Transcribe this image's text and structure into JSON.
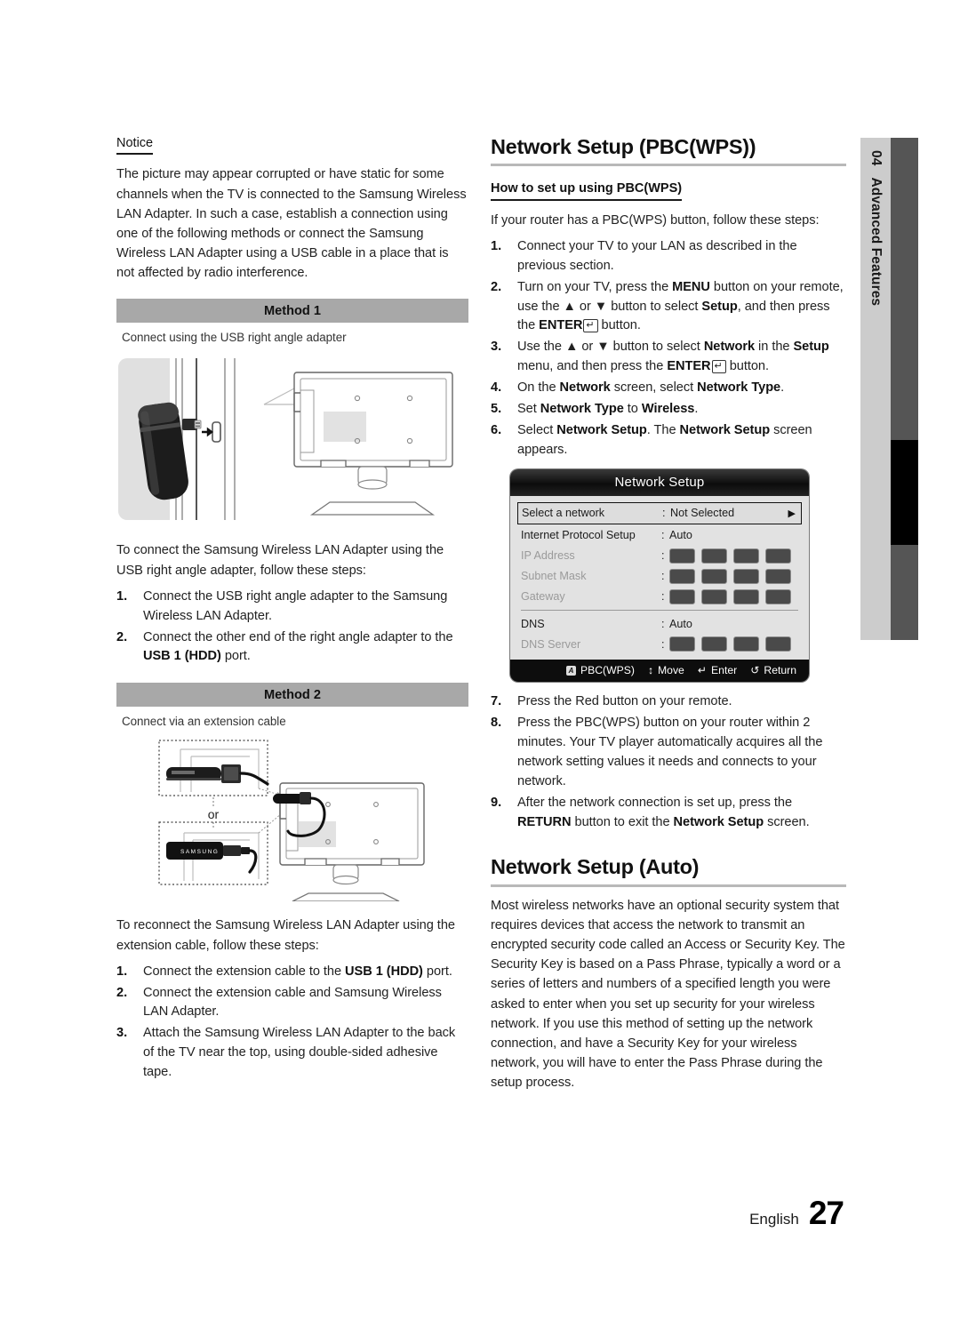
{
  "chapter": {
    "number": "04",
    "title": "Advanced Features"
  },
  "footer": {
    "language": "English",
    "page": "27"
  },
  "left_column": {
    "notice_heading": "Notice",
    "notice_body": "The picture may appear corrupted or have static for some channels when the TV is connected to the Samsung Wireless LAN Adapter. In such a case, establish a connection using one of the following methods or connect the Samsung Wireless LAN Adapter using a USB cable in a place that is not affected by radio interference.",
    "method1": {
      "bar_label": "Method 1",
      "caption": "Connect using the USB right angle adapter",
      "intro": "To connect the Samsung Wireless LAN Adapter using the USB right angle adapter, follow these steps:",
      "steps": [
        {
          "num": "1.",
          "text": "Connect the USB right angle adapter to the Samsung Wireless LAN Adapter."
        },
        {
          "num": "2.",
          "text": "Connect the other end of the right angle adapter to the USB 1 (HDD) port."
        }
      ]
    },
    "method2": {
      "bar_label": "Method 2",
      "caption": "Connect via an extension cable",
      "or_label": "or",
      "brand_label": "SAMSUNG",
      "intro": "To reconnect the Samsung Wireless LAN Adapter using the extension cable, follow these steps:",
      "steps": [
        {
          "num": "1.",
          "text": "Connect the extension cable to the USB 1 (HDD) port."
        },
        {
          "num": "2.",
          "text": "Connect the extension cable and Samsung Wireless LAN Adapter."
        },
        {
          "num": "3.",
          "text": "Attach the Samsung Wireless LAN Adapter to the back of the TV near the top, using double-sided adhesive tape."
        }
      ]
    }
  },
  "right_column": {
    "section1": {
      "heading": "Network Setup (PBC(WPS))",
      "subheading": "How to set up using PBC(WPS)",
      "intro": "If your router has a PBC(WPS) button, follow these steps:",
      "steps_before": [
        {
          "num": "1.",
          "text": "Connect your TV to your LAN as described in the previous section."
        },
        {
          "num": "2.",
          "text": "Turn on your TV, press the MENU button on your remote, use the ▲ or ▼ button to select Setup, and then press the ENTER button."
        },
        {
          "num": "3.",
          "text": "Use the ▲ or ▼ button to select Network in the Setup menu, and then press the ENTER button."
        },
        {
          "num": "4.",
          "text": "On the Network screen, select Network Type."
        },
        {
          "num": "5.",
          "text": "Set Network Type to Wireless."
        },
        {
          "num": "6.",
          "text": "Select Network Setup. The Network Setup screen appears."
        }
      ],
      "steps_after": [
        {
          "num": "7.",
          "text": "Press the Red button on your remote."
        },
        {
          "num": "8.",
          "text": "Press the PBC(WPS) button on your router within 2 minutes. Your TV player automatically acquires all the network setting values it needs and connects to your network."
        },
        {
          "num": "9.",
          "text": "After the network connection is set up, press the RETURN button to exit the Network Setup screen."
        }
      ]
    },
    "section2": {
      "heading": "Network Setup (Auto)",
      "body": "Most wireless networks have an optional security system that requires devices that access the network to transmit an encrypted security code called an Access or Security Key. The Security Key is based on a Pass Phrase, typically a word or a series of letters and numbers of a specified length you were asked to enter when you set up security for your wireless network. If you use this method of setting up the network connection, and have a Security Key for your wireless network, you will have to enter the Pass Phrase during the setup process."
    }
  },
  "osd": {
    "title": "Network Setup",
    "rows": [
      {
        "label": "Select a network",
        "value": "Not Selected",
        "selected": true,
        "arrow": "▶"
      },
      {
        "label": "Internet Protocol Setup",
        "value": "Auto",
        "selected": false
      },
      {
        "label": "IP Address",
        "value": "",
        "dim": true,
        "boxes": 4
      },
      {
        "label": "Subnet Mask",
        "value": "",
        "dim": true,
        "boxes": 4
      },
      {
        "label": "Gateway",
        "value": "",
        "dim": true,
        "boxes": 4
      },
      {
        "label": "DNS",
        "value": "Auto",
        "selected": false
      },
      {
        "label": "DNS Server",
        "value": "",
        "dim": true,
        "boxes": 4
      }
    ],
    "footer": [
      {
        "key": "A",
        "label": "PBC(WPS)"
      },
      {
        "key": "↕",
        "label": "Move"
      },
      {
        "key": "↵",
        "label": "Enter"
      },
      {
        "key": "↺",
        "label": "Return"
      }
    ]
  }
}
